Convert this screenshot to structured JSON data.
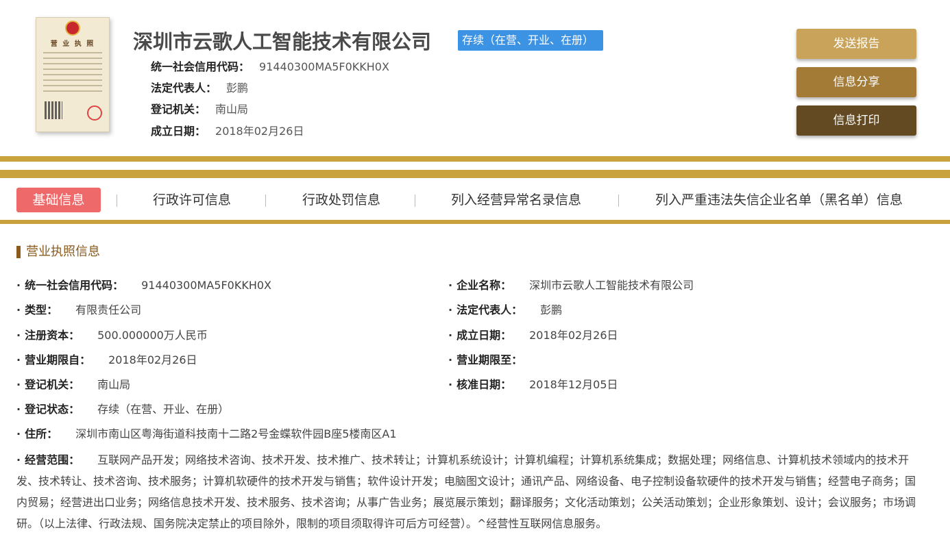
{
  "company": {
    "name": "深圳市云歌人工智能技术有限公司",
    "status": "存续（在营、开业、在册）"
  },
  "license_image": {
    "title": "营 业 执 照"
  },
  "summary": [
    {
      "label": "统一社会信用代码：",
      "value": "91440300MA5F0KKH0X"
    },
    {
      "label": "法定代表人：",
      "value": "彭鹏"
    },
    {
      "label": "登记机关：",
      "value": "南山局"
    },
    {
      "label": "成立日期：",
      "value": "2018年02月26日"
    }
  ],
  "actions": {
    "send_report": "发送报告",
    "share": "信息分享",
    "print": "信息打印"
  },
  "tabs": [
    {
      "label": "基础信息",
      "active": true
    },
    {
      "label": "行政许可信息",
      "active": false
    },
    {
      "label": "行政处罚信息",
      "active": false
    },
    {
      "label": "列入经营异常名录信息",
      "active": false
    },
    {
      "label": "列入严重违法失信企业名单（黑名单）信息",
      "active": false
    }
  ],
  "section": {
    "title": "营业执照信息",
    "left": [
      {
        "label": "统一社会信用代码：",
        "value": "91440300MA5F0KKH0X"
      },
      {
        "label": "类型：",
        "value": "有限责任公司"
      },
      {
        "label": "注册资本：",
        "value": "500.000000万人民币"
      },
      {
        "label": "营业期限自：",
        "value": "2018年02月26日"
      },
      {
        "label": "登记机关：",
        "value": "南山局"
      },
      {
        "label": "登记状态：",
        "value": "存续（在营、开业、在册）"
      },
      {
        "label": "住所：",
        "value": "深圳市南山区粤海街道科技南十二路2号金蝶软件园B座5楼南区A1"
      }
    ],
    "right": [
      {
        "label": "企业名称：",
        "value": "深圳市云歌人工智能技术有限公司"
      },
      {
        "label": "法定代表人：",
        "value": "彭鹏"
      },
      {
        "label": "成立日期：",
        "value": "2018年02月26日"
      },
      {
        "label": "营业期限至：",
        "value": ""
      },
      {
        "label": "核准日期：",
        "value": "2018年12月05日"
      }
    ],
    "scope": {
      "label": "经营范围：",
      "value": "互联网产品开发；网络技术咨询、技术开发、技术推广、技术转让；计算机系统设计；计算机编程；计算机系统集成；数据处理；网络信息、计算机技术领域内的技术开发、技术转让、技术咨询、技术服务；计算机软硬件的技术开发与销售；软件设计开发；电脑图文设计；通讯产品、网络设备、电子控制设备软硬件的技术开发与销售；经营电子商务；国内贸易；经营进出口业务；网络信息技术开发、技术服务、技术咨询；从事广告业务；展览展示策划；翻译服务；文化活动策划；公关活动策划；企业形象策划、设计；会议服务；市场调研。（以上法律、行政法规、国务院决定禁止的项目除外，限制的项目须取得许可后方可经营）。^经营性互联网信息服务。"
    }
  }
}
